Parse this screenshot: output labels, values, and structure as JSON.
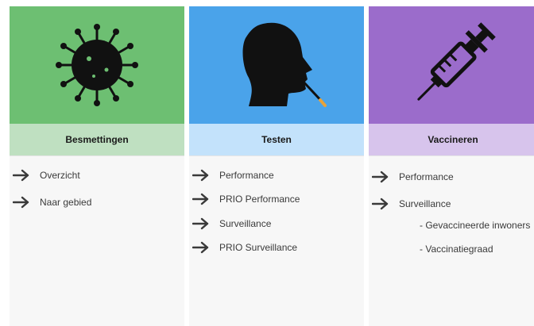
{
  "cards": [
    {
      "title": "Besmettingen",
      "tile_color": "#6dbf72",
      "label_color": "#bfe0c1",
      "icon": "virus-icon",
      "links": [
        "Overzicht",
        "Naar gebied"
      ]
    },
    {
      "title": "Testen",
      "tile_color": "#4aa3ea",
      "label_color": "#c3e2fb",
      "icon": "nose-swab-test-icon",
      "links": [
        "Performance",
        "PRIO Performance",
        "Surveillance",
        "PRIO Surveillance"
      ]
    },
    {
      "title": "Vaccineren",
      "tile_color": "#9b6ccb",
      "label_color": "#d7c4ec",
      "icon": "syringe-icon",
      "links": [
        "Performance",
        "Surveillance"
      ],
      "sublinks": [
        "- Gevaccineerde inwoners",
        "- Vaccinatiegraad"
      ]
    }
  ]
}
